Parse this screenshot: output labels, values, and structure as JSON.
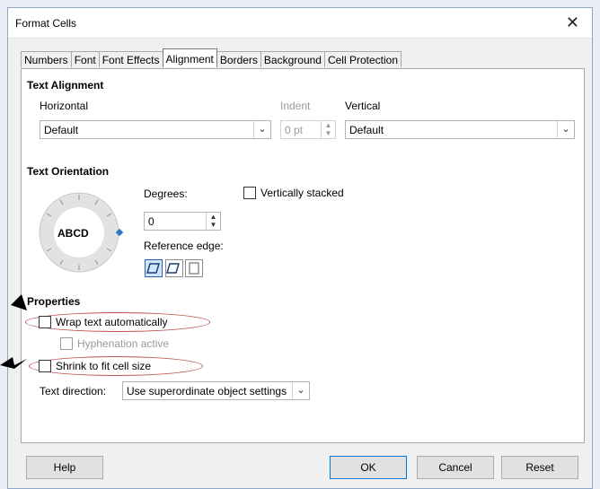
{
  "dialog": {
    "title": "Format Cells",
    "close_glyph": "✕"
  },
  "tabs": [
    "Numbers",
    "Font",
    "Font Effects",
    "Alignment",
    "Borders",
    "Background",
    "Cell Protection"
  ],
  "active_tab": "Alignment",
  "text_alignment": {
    "heading": "Text Alignment",
    "horizontal_label": "Horizontal",
    "horizontal_value": "Default",
    "indent_label": "Indent",
    "indent_value": "0 pt",
    "vertical_label": "Vertical",
    "vertical_value": "Default"
  },
  "text_orientation": {
    "heading": "Text Orientation",
    "dial_text": "ABCD",
    "degrees_label": "Degrees:",
    "degrees_value": "0",
    "vertically_stacked_label": "Vertically stacked",
    "reference_edge_label": "Reference edge:"
  },
  "properties": {
    "heading": "Properties",
    "wrap_text_label": "Wrap text automatically",
    "hyphenation_label": "Hyphenation active",
    "shrink_label": "Shrink to fit cell size",
    "text_direction_label": "Text direction:",
    "text_direction_value": "Use superordinate object settings"
  },
  "buttons": {
    "help": "Help",
    "ok": "OK",
    "cancel": "Cancel",
    "reset": "Reset"
  },
  "icons": {
    "dropdown": "chevron-down-icon",
    "spin": "spin-arrows-icon"
  },
  "colors": {
    "annotation_ellipse": "#c0504d",
    "default_button_border": "#0078d7"
  }
}
